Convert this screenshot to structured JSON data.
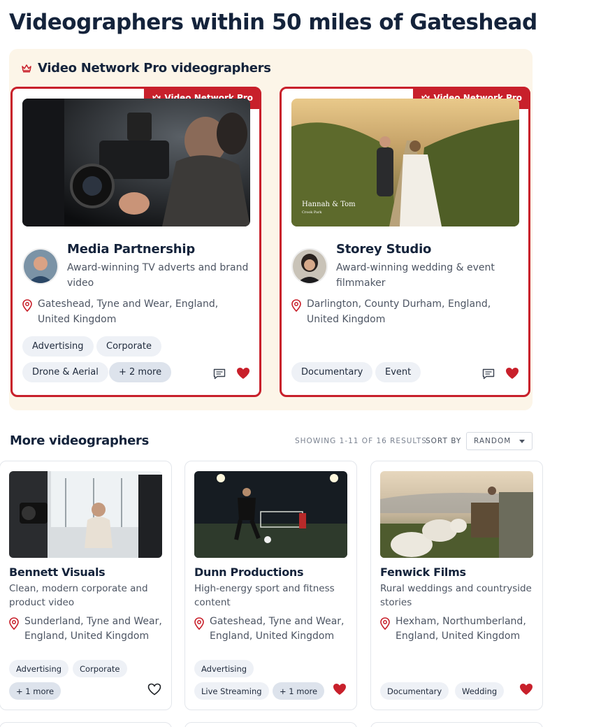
{
  "page": {
    "title": "Videographers within 50 miles of Gateshead"
  },
  "pro_section": {
    "title": "Video Network Pro videographers",
    "badge_label": "Video Network Pro",
    "cards": [
      {
        "name": "Media Partnership",
        "tagline": "Award-winning TV adverts and brand video",
        "location": "Gateshead, Tyne and Wear, England, United Kingdom",
        "tags": [
          "Advertising",
          "Corporate",
          "Drone & Aerial"
        ],
        "more": "+ 2 more",
        "favourited": true
      },
      {
        "name": "Storey Studio",
        "tagline": "Award-winning wedding & event filmmaker",
        "location": "Darlington, County Durham, England, United Kingdom",
        "photo_caption": "Hannah & Tom",
        "photo_subcaption": "Crook Park",
        "tags": [
          "Documentary",
          "Event"
        ],
        "favourited": true
      }
    ]
  },
  "more_section": {
    "title": "More videographers",
    "showing": "SHOWING 1-11 OF 16 RESULTS",
    "sort_label": "SORT BY",
    "sort_value": "RANDOM",
    "cards": [
      {
        "name": "Bennett Visuals",
        "tagline": "Clean, modern corporate and product video",
        "location": "Sunderland, Tyne and Wear, England, United Kingdom",
        "tags": [
          "Advertising",
          "Corporate"
        ],
        "more": "+ 1 more",
        "favourited": false
      },
      {
        "name": "Dunn Productions",
        "tagline": "High-energy sport and fitness content",
        "location": "Gateshead, Tyne and Wear, England, United Kingdom",
        "tags": [
          "Advertising",
          "Live Streaming"
        ],
        "more": "+ 1 more",
        "favourited": true
      },
      {
        "name": "Fenwick Films",
        "tagline": "Rural weddings and countryside stories",
        "location": "Hexham, Northumberland, England, United Kingdom",
        "tags": [
          "Documentary",
          "Wedding"
        ],
        "favourited": true
      }
    ]
  },
  "colors": {
    "brand_red": "#c8202b",
    "panel_bg": "#fcf5e8",
    "heading": "#14233b"
  },
  "icons": [
    "crown-icon",
    "location-pin-icon",
    "message-icon",
    "heart-filled-icon",
    "heart-outline-icon",
    "chevron-down-icon"
  ]
}
